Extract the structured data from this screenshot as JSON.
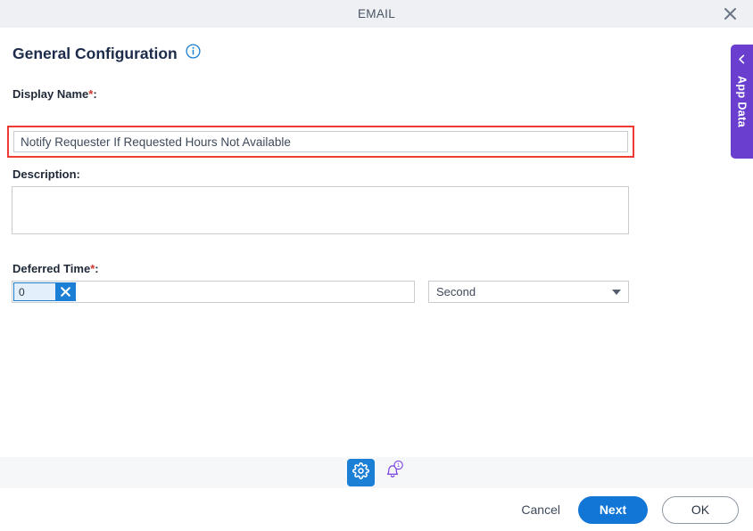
{
  "window": {
    "title": "EMAIL",
    "close_icon": "close-icon"
  },
  "section": {
    "title": "General Configuration",
    "info_icon": "info-icon"
  },
  "fields": {
    "display_name": {
      "label": "Display Name",
      "required_marker": "*",
      "colon": ":",
      "value": "Notify Requester If Requested Hours Not Available",
      "placeholder": "",
      "validation_color": "#ef3b34"
    },
    "description": {
      "label": "Description",
      "colon": ":",
      "value": "",
      "placeholder": ""
    },
    "deferred_time": {
      "label": "Deferred Time",
      "required_marker": "*",
      "colon": ":",
      "token_value": "0",
      "clear_icon": "close-icon",
      "unit_value": "Second",
      "unit_caret_icon": "chevron-down-icon"
    }
  },
  "app_data_tab": {
    "label": "App Data",
    "chevron_icon": "chevron-left-icon",
    "color": "#6a3ecf"
  },
  "toolbar": {
    "settings_icon": "gear-icon",
    "notifications_icon": "bell-icon",
    "notifications_badge": "1",
    "accent_color": "#1b7fd6",
    "badge_color": "#7b3fe4"
  },
  "footer": {
    "cancel_label": "Cancel",
    "next_label": "Next",
    "ok_label": "OK"
  }
}
